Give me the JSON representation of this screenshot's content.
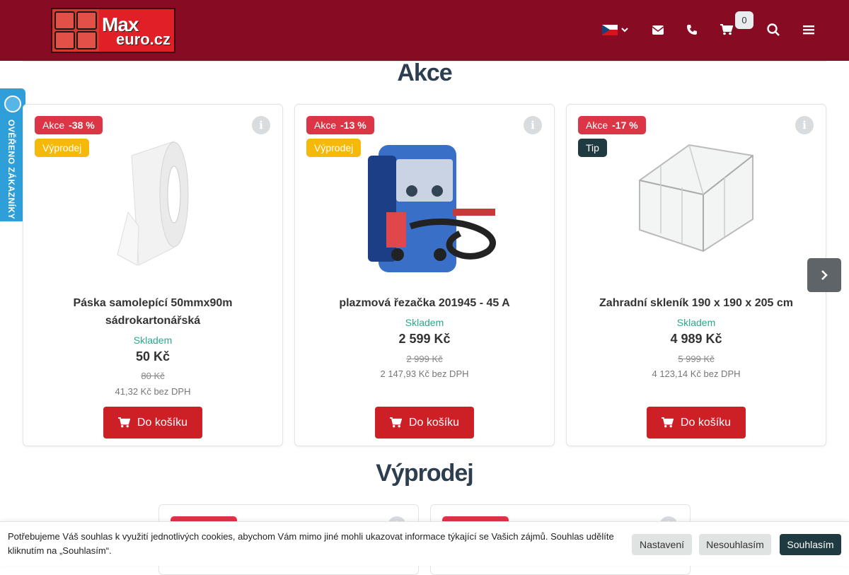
{
  "header": {
    "logo_max": "Max",
    "logo_euro": "euro.cz",
    "language": "CZ",
    "cart_count": "0",
    "icons": [
      "flag-cz-icon",
      "chevron-down-icon",
      "envelope-icon",
      "phone-icon",
      "cart-icon",
      "search-icon",
      "menu-icon"
    ],
    "bg_color": "#870b23"
  },
  "verified_badge": {
    "text": "OVĚŘENO ZÁKAZNÍKY",
    "color": "#2e9fd8"
  },
  "sections": {
    "akce_title": "Akce",
    "vyprodej_title": "Výprodej"
  },
  "products": [
    {
      "badge_akce": "Akce",
      "discount": "-38 %",
      "badge_second": "Výprodej",
      "name": "Páska samolepící 50mmx90m sádrokartonářská",
      "stock": "Skladem",
      "price": "50 Kč",
      "old_price": "80 Kč",
      "net_price": "41,32 Kč bez DPH",
      "button": "Do košíku"
    },
    {
      "badge_akce": "Akce",
      "discount": "-13 %",
      "badge_second": "Výprodej",
      "name": "plazmová řezačka 201945 - 45 A",
      "stock": "Skladem",
      "price": "2 599 Kč",
      "old_price": "2 999 Kč",
      "net_price": "2 147,93 Kč bez DPH",
      "button": "Do košíku"
    },
    {
      "badge_akce": "Akce",
      "discount": "-17 %",
      "badge_second": "Tip",
      "name": "Zahradní skleník 190 x 190 x 205 cm",
      "stock": "Skladem",
      "price": "4 989 Kč",
      "old_price": "5 999 Kč",
      "net_price": "4 123,14 Kč bez DPH",
      "button": "Do košíku"
    }
  ],
  "cookie": {
    "text": "Potřebujeme Váš souhlas k využití jednotlivých cookies, abychom Vám mimo jiné mohli ukazovat informace týkající se Vašich zájmů. Souhlas udělíte kliknutím na „Souhlasím“.",
    "settings": "Nastavení",
    "decline": "Nesouhlasím",
    "accept": "Souhlasím"
  }
}
